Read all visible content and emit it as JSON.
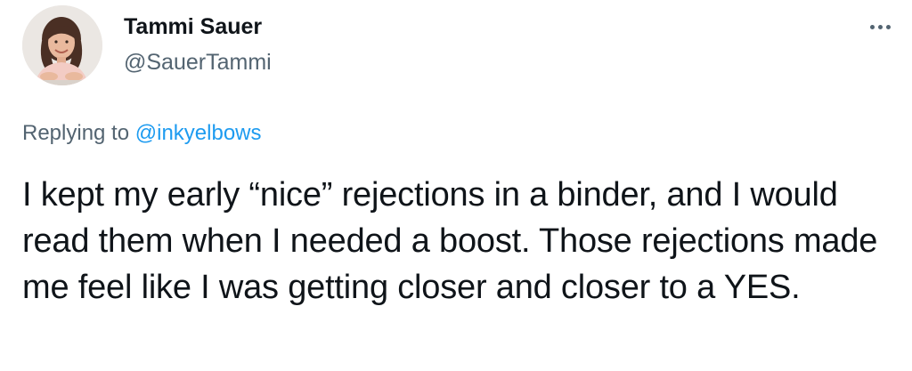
{
  "author": {
    "display_name": "Tammi Sauer",
    "handle": "@SauerTammi",
    "avatar_icon": "profile-photo"
  },
  "menu": {
    "more_icon": "more-horizontal-icon"
  },
  "reply": {
    "prefix": "Replying to",
    "target": "@inkyelbows"
  },
  "tweet": {
    "text": "I kept my early “nice” rejections in a binder, and I would read them when I needed a boost. Those rejections made me feel like I was getting closer and closer to a YES."
  },
  "colors": {
    "text_primary": "#0f1419",
    "text_secondary": "#536471",
    "link": "#1d9bf0"
  }
}
